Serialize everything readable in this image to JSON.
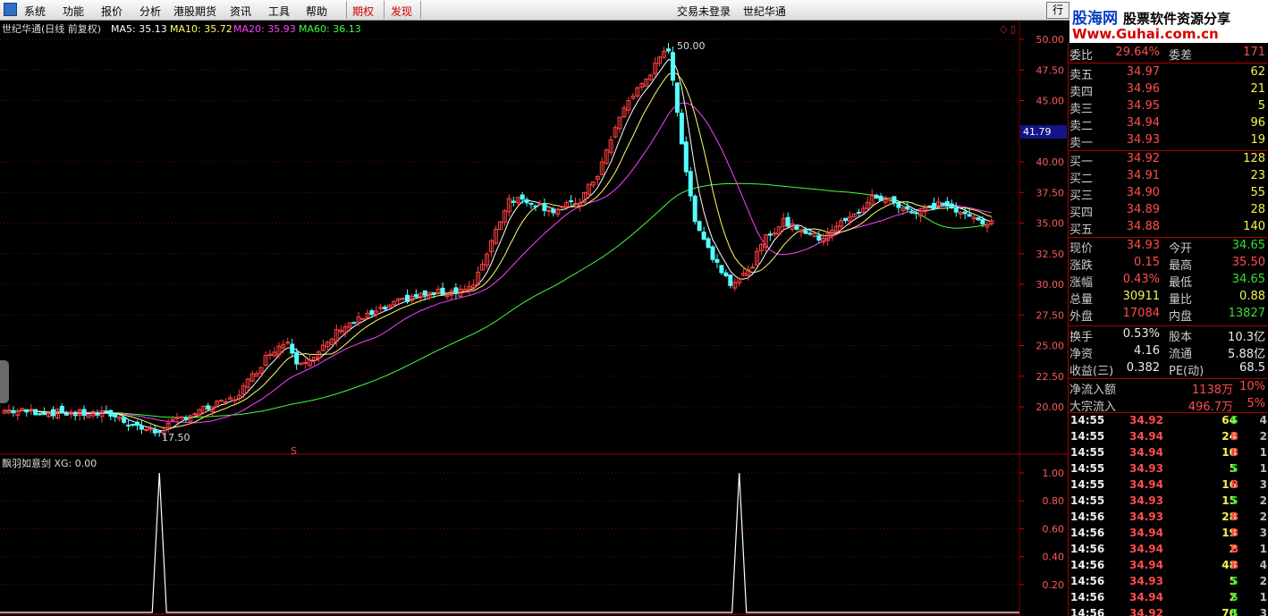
{
  "menu": {
    "items": [
      "系统",
      "功能",
      "报价",
      "分析",
      "港股期货",
      "资讯",
      "工具",
      "帮助"
    ],
    "highlight_items": [
      "期权",
      "发现"
    ],
    "status": "交易未登录",
    "stock_name": "世纪华通",
    "right_button": "行"
  },
  "brand": {
    "name": "股海网",
    "tagline": "股票软件资源分享",
    "url": "Www.Guhai.com.cn"
  },
  "chart": {
    "title": "世纪华通(日线 前复权)",
    "ma5": "MA5: 35.13",
    "ma10": "MA10: 35.72",
    "ma20": "MA20: 35.93",
    "ma60": "MA60: 36.13",
    "y_ticks": [
      "50.00",
      "47.50",
      "45.00",
      "40.00",
      "37.50",
      "35.00",
      "32.50",
      "30.00",
      "27.50",
      "25.00",
      "22.50",
      "20.00"
    ],
    "high_label": "50.00",
    "low_label": "17.50",
    "current_price_tag": "41.79",
    "marker": "S",
    "colors": {
      "up": "#ff4040",
      "down": "#54ffff",
      "ma5": "#ffffff",
      "ma10": "#ffff66",
      "ma20": "#ff40ff",
      "ma60": "#40ff40",
      "grid": "#7a0000"
    }
  },
  "indicator": {
    "title": "飘羽如意剑  XG: 0.00",
    "y_ticks": [
      "1.00",
      "0.80",
      "0.60",
      "0.40",
      "0.20"
    ],
    "signals": [
      1,
      1
    ]
  },
  "quote": {
    "committee": {
      "label": "委比",
      "value": "29.64%",
      "label2": "委差",
      "value2": "171"
    },
    "asks": [
      {
        "label": "卖五",
        "price": "34.97",
        "vol": "62"
      },
      {
        "label": "卖四",
        "price": "34.96",
        "vol": "21"
      },
      {
        "label": "卖三",
        "price": "34.95",
        "vol": "5"
      },
      {
        "label": "卖二",
        "price": "34.94",
        "vol": "96"
      },
      {
        "label": "卖一",
        "price": "34.93",
        "vol": "19"
      }
    ],
    "bids": [
      {
        "label": "买一",
        "price": "34.92",
        "vol": "128"
      },
      {
        "label": "买二",
        "price": "34.91",
        "vol": "23"
      },
      {
        "label": "买三",
        "price": "34.90",
        "vol": "55"
      },
      {
        "label": "买四",
        "price": "34.89",
        "vol": "28"
      },
      {
        "label": "买五",
        "price": "34.88",
        "vol": "140"
      }
    ],
    "stats": [
      {
        "l1": "现价",
        "v1": "34.93",
        "l2": "今开",
        "v2": "34.65"
      },
      {
        "l1": "涨跌",
        "v1": "0.15",
        "l2": "最高",
        "v2": "35.50"
      },
      {
        "l1": "涨幅",
        "v1": "0.43%",
        "l2": "最低",
        "v2": "34.65"
      },
      {
        "l1": "总量",
        "v1": "30911",
        "l2": "量比",
        "v2": "0.88"
      },
      {
        "l1": "外盘",
        "v1": "17084",
        "l2": "内盘",
        "v2": "13827"
      }
    ],
    "fundamentals": [
      {
        "l1": "换手",
        "v1": "0.53%",
        "l2": "股本",
        "v2": "10.3亿"
      },
      {
        "l1": "净资",
        "v1": "4.16",
        "l2": "流通",
        "v2": "5.88亿"
      },
      {
        "l1": "收益(三)",
        "v1": "0.382",
        "l2": "PE(动)",
        "v2": "68.5"
      }
    ],
    "flows": [
      {
        "label": "净流入额",
        "value": "1138万",
        "pct": "10%"
      },
      {
        "label": "大宗流入",
        "value": "496.7万",
        "pct": "5%"
      }
    ],
    "ticks": [
      {
        "time": "14:55",
        "price": "34.92",
        "vol": "64",
        "side": "S",
        "n": "4"
      },
      {
        "time": "14:55",
        "price": "34.94",
        "vol": "24",
        "side": "B",
        "n": "2"
      },
      {
        "time": "14:55",
        "price": "34.94",
        "vol": "10",
        "side": "B",
        "n": "1"
      },
      {
        "time": "14:55",
        "price": "34.93",
        "vol": "5",
        "side": "S",
        "n": "1"
      },
      {
        "time": "14:55",
        "price": "34.94",
        "vol": "16",
        "side": "B",
        "n": "3"
      },
      {
        "time": "14:55",
        "price": "34.93",
        "vol": "15",
        "side": "S",
        "n": "2"
      },
      {
        "time": "14:56",
        "price": "34.93",
        "vol": "28",
        "side": "B",
        "n": "2"
      },
      {
        "time": "14:56",
        "price": "34.94",
        "vol": "19",
        "side": "B",
        "n": "3"
      },
      {
        "time": "14:56",
        "price": "34.94",
        "vol": "2",
        "side": "B",
        "n": "1"
      },
      {
        "time": "14:56",
        "price": "34.94",
        "vol": "48",
        "side": "B",
        "n": "4"
      },
      {
        "time": "14:56",
        "price": "34.93",
        "vol": "5",
        "side": "S",
        "n": "2"
      },
      {
        "time": "14:56",
        "price": "34.94",
        "vol": "2",
        "side": "S",
        "n": "1"
      },
      {
        "time": "14:56",
        "price": "34.92",
        "vol": "70",
        "side": "S",
        "n": "3"
      }
    ]
  }
}
